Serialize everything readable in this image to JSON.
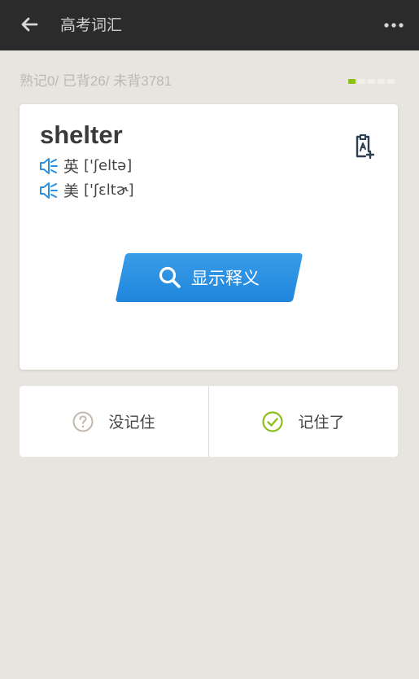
{
  "header": {
    "title": "高考词汇",
    "back_icon": "arrow-left-icon",
    "more_icon": "more-dots-icon"
  },
  "stats": {
    "text": "熟记0/ 已背26/ 未背3781"
  },
  "progress": {
    "current_page": 1,
    "total_pages": 5,
    "active_color": "#8cbf1c"
  },
  "card": {
    "word": "shelter",
    "uk_label": "英",
    "uk_ipa": "['ʃeltə]",
    "us_label": "美",
    "us_ipa": "['ʃɛltɚ]",
    "speaker_icon": "speaker-icon",
    "add_icon": "add-to-wordbook-icon",
    "show_button_label": "显示释义",
    "show_button_icon": "search-icon",
    "accent_color": "#1f86dc"
  },
  "answers": {
    "forgot_label": "没记住",
    "forgot_icon": "question-circle-icon",
    "remembered_label": "记住了",
    "remembered_icon": "check-circle-icon",
    "check_color": "#8cbf1c"
  }
}
